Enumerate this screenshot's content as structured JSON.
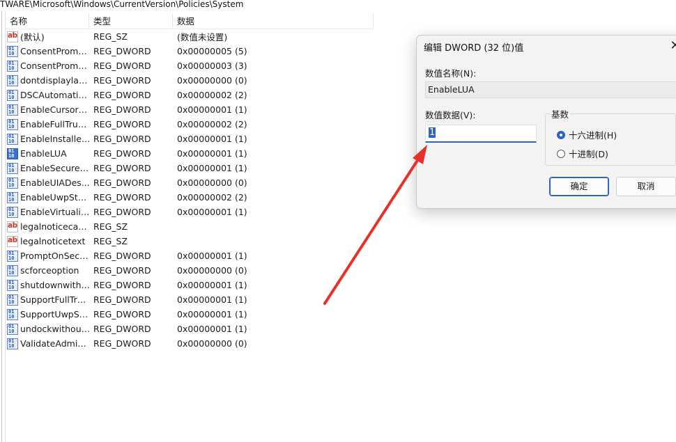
{
  "path": "TWARE\\Microsoft\\Windows\\CurrentVersion\\Policies\\System",
  "columns": {
    "name": "名称",
    "type": "类型",
    "data": "数据"
  },
  "values": [
    {
      "icon": "string-value-icon",
      "name": "(默认)",
      "type": "REG_SZ",
      "data": "(数值未设置)"
    },
    {
      "icon": "dword-value-icon",
      "name": "ConsentPromp...",
      "type": "REG_DWORD",
      "data": "0x00000005 (5)"
    },
    {
      "icon": "dword-value-icon",
      "name": "ConsentPromp...",
      "type": "REG_DWORD",
      "data": "0x00000003 (3)"
    },
    {
      "icon": "dword-value-icon",
      "name": "dontdisplaylas...",
      "type": "REG_DWORD",
      "data": "0x00000000 (0)"
    },
    {
      "icon": "dword-value-icon",
      "name": "DSCAutomatio...",
      "type": "REG_DWORD",
      "data": "0x00000002 (2)"
    },
    {
      "icon": "dword-value-icon",
      "name": "EnableCursorS...",
      "type": "REG_DWORD",
      "data": "0x00000001 (1)"
    },
    {
      "icon": "dword-value-icon",
      "name": "EnableFullTrust...",
      "type": "REG_DWORD",
      "data": "0x00000002 (2)"
    },
    {
      "icon": "dword-value-icon",
      "name": "EnableInstaller...",
      "type": "REG_DWORD",
      "data": "0x00000001 (1)"
    },
    {
      "icon": "dword-value-icon",
      "name": "EnableLUA",
      "type": "REG_DWORD",
      "data": "0x00000001 (1)"
    },
    {
      "icon": "dword-value-icon",
      "name": "EnableSecureU...",
      "type": "REG_DWORD",
      "data": "0x00000001 (1)"
    },
    {
      "icon": "dword-value-icon",
      "name": "EnableUIADes...",
      "type": "REG_DWORD",
      "data": "0x00000000 (0)"
    },
    {
      "icon": "dword-value-icon",
      "name": "EnableUwpSta...",
      "type": "REG_DWORD",
      "data": "0x00000002 (2)"
    },
    {
      "icon": "dword-value-icon",
      "name": "EnableVirtualiz...",
      "type": "REG_DWORD",
      "data": "0x00000001 (1)"
    },
    {
      "icon": "string-value-icon",
      "name": "legalnoticecap...",
      "type": "REG_SZ",
      "data": ""
    },
    {
      "icon": "string-value-icon",
      "name": "legalnoticetext",
      "type": "REG_SZ",
      "data": ""
    },
    {
      "icon": "dword-value-icon",
      "name": "PromptOnSecu...",
      "type": "REG_DWORD",
      "data": "0x00000001 (1)"
    },
    {
      "icon": "dword-value-icon",
      "name": "scforceoption",
      "type": "REG_DWORD",
      "data": "0x00000000 (0)"
    },
    {
      "icon": "dword-value-icon",
      "name": "shutdownwitho...",
      "type": "REG_DWORD",
      "data": "0x00000001 (1)"
    },
    {
      "icon": "dword-value-icon",
      "name": "SupportFullTru...",
      "type": "REG_DWORD",
      "data": "0x00000001 (1)"
    },
    {
      "icon": "dword-value-icon",
      "name": "SupportUwpSt...",
      "type": "REG_DWORD",
      "data": "0x00000001 (1)"
    },
    {
      "icon": "dword-value-icon",
      "name": "undockwithout...",
      "type": "REG_DWORD",
      "data": "0x00000001 (1)"
    },
    {
      "icon": "dword-value-icon",
      "name": "ValidateAdmin...",
      "type": "REG_DWORD",
      "data": "0x00000000 (0)"
    }
  ],
  "selected_value": "EnableLUA",
  "dialog": {
    "title": "编辑 DWORD (32 位)值",
    "close_icon": "close-icon",
    "name_label": "数值名称(N):",
    "name_value": "EnableLUA",
    "data_label": "数值数据(V):",
    "data_value": "1",
    "radix_title": "基数",
    "radix_hex": "十六进制(H)",
    "radix_dec": "十进制(D)",
    "radix_selected": "hex",
    "ok_label": "确定",
    "cancel_label": "取消"
  },
  "annotation_color": "#e8302a"
}
